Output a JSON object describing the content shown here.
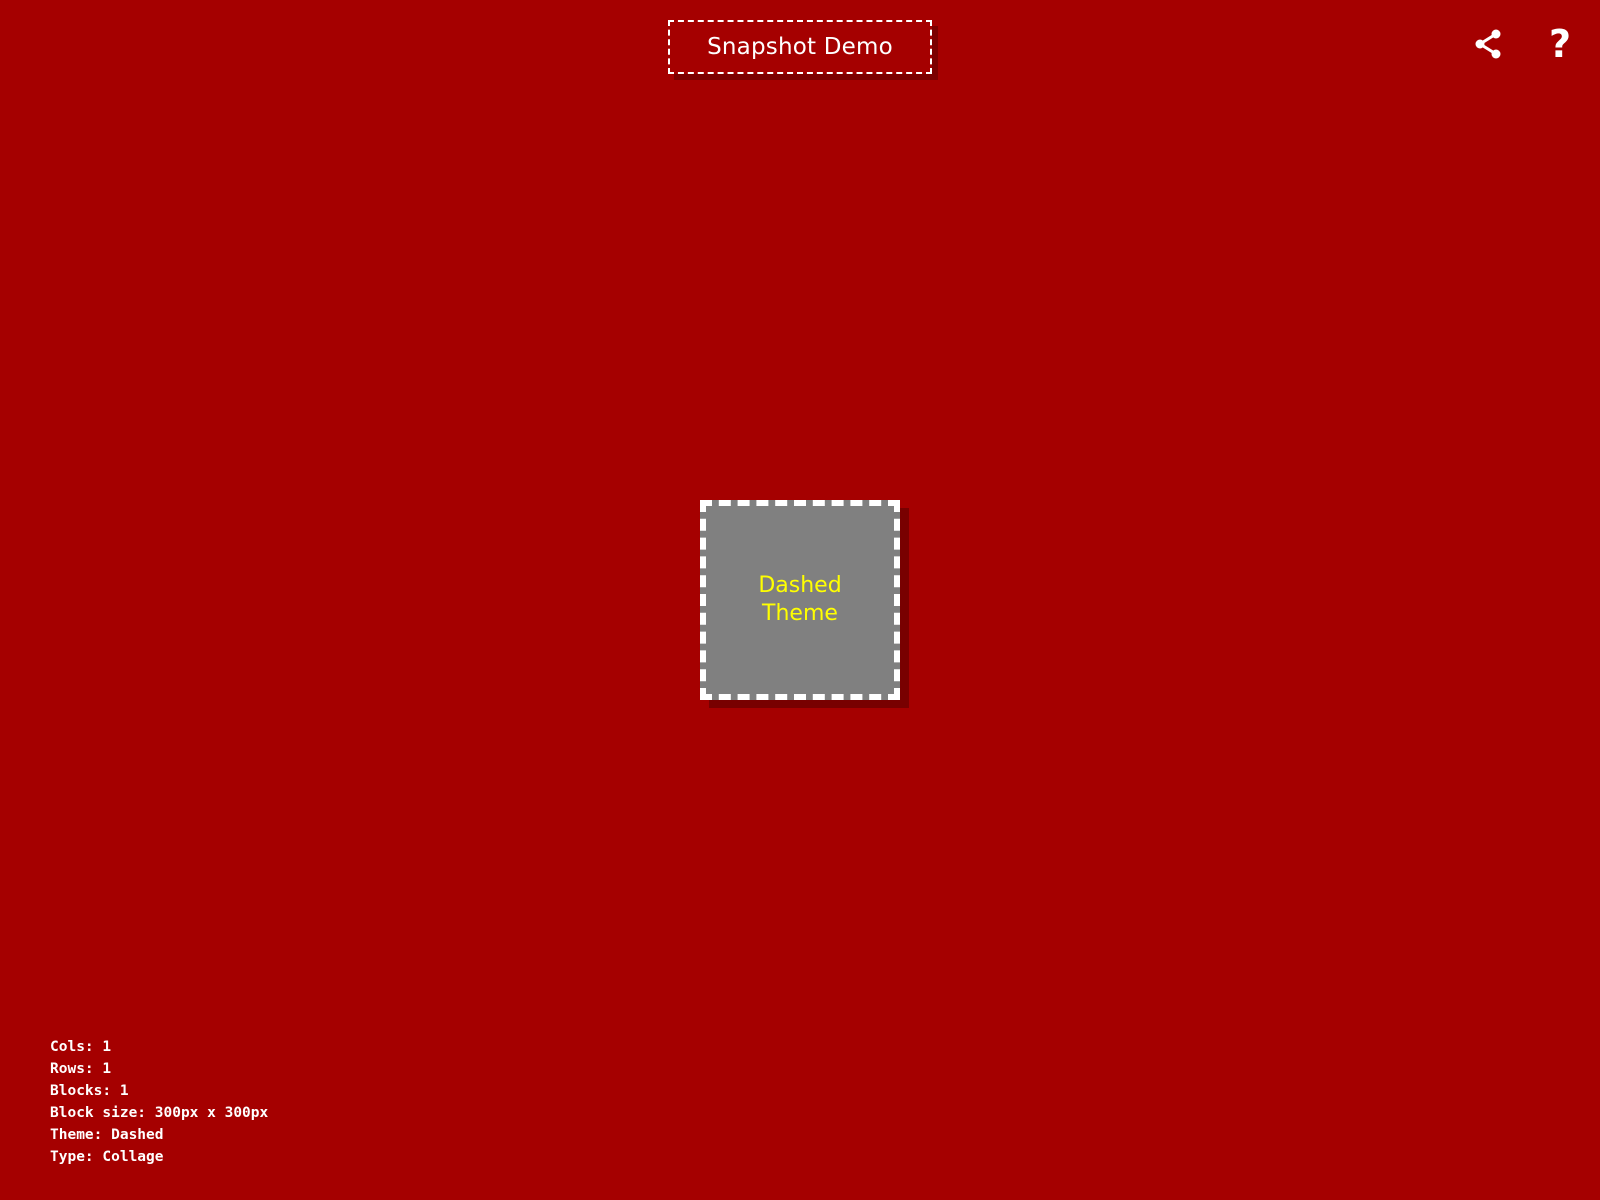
{
  "header": {
    "title": "Snapshot Demo",
    "share_icon": "share-icon",
    "help_icon": "help-icon",
    "help_glyph": "?"
  },
  "block": {
    "label": "Dashed Theme"
  },
  "info": {
    "cols": "Cols: 1",
    "rows": "Rows: 1",
    "blocks": "Blocks: 1",
    "block_size": "Block size: 300px x 300px",
    "theme": "Theme: Dashed",
    "type": "Type: Collage"
  },
  "colors": {
    "background": "#a50000",
    "block_fill": "#808080",
    "block_text": "#ffff00",
    "border": "#ffffff"
  }
}
